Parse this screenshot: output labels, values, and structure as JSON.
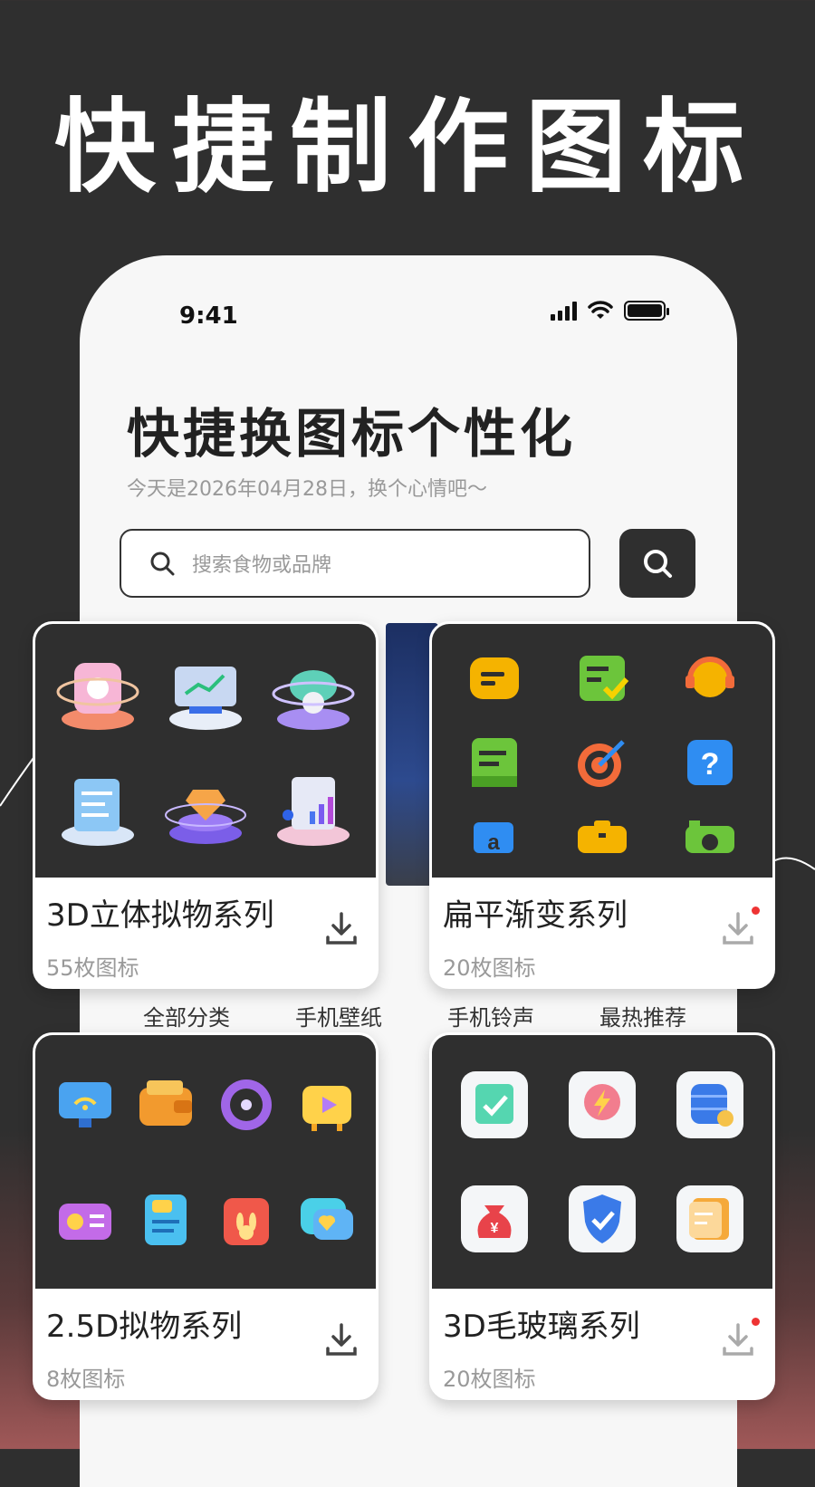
{
  "hero": {
    "title": "快捷制作图标"
  },
  "status_bar": {
    "time": "9:41"
  },
  "app": {
    "heading": "快捷换图标个性化",
    "subtitle": "今天是2026年04月28日，换个心情吧～",
    "search": {
      "placeholder": "搜索食物或品牌"
    }
  },
  "category_nav": [
    {
      "label": "全部分类"
    },
    {
      "label": "手机壁纸"
    },
    {
      "label": "手机铃声"
    },
    {
      "label": "最热推荐"
    }
  ],
  "cards": [
    {
      "title": "3D立体拟物系列",
      "count": "55枚图标",
      "has_badge": false,
      "icons": [
        "3d-gift-box-icon",
        "3d-chart-monitor-icon",
        "3d-cloud-gear-icon",
        "3d-document-icon",
        "3d-diamond-icon",
        "3d-report-icon"
      ]
    },
    {
      "title": "扁平渐变系列",
      "count": "20枚图标",
      "has_badge": true,
      "icons": [
        "chat-bubble-icon",
        "checklist-icon",
        "headset-icon",
        "notes-icon",
        "target-icon",
        "help-icon",
        "translate-icon",
        "toolbox-icon",
        "camera-icon"
      ]
    },
    {
      "title": "2.5D拟物系列",
      "count": "8枚图标",
      "has_badge": false,
      "icons": [
        "wifi-monitor-icon",
        "wallet-icon",
        "music-disc-icon",
        "video-play-icon",
        "radio-icon",
        "study-book-icon",
        "rabbit-bag-icon",
        "heart-chat-icon"
      ]
    },
    {
      "title": "3D毛玻璃系列",
      "count": "20枚图标",
      "has_badge": true,
      "icons": [
        "calendar-check-icon",
        "flash-charge-icon",
        "coin-database-icon",
        "money-bag-icon",
        "shield-check-icon",
        "document-stack-icon"
      ]
    }
  ],
  "colors": {
    "background": "#2f2f2f",
    "phone_surface": "#f7f7f7",
    "badge": "#e33333",
    "flat_yellow": "#f5b300",
    "flat_green": "#6cc53b",
    "flat_orange": "#f26b3a",
    "flat_blue": "#2f8df2"
  }
}
